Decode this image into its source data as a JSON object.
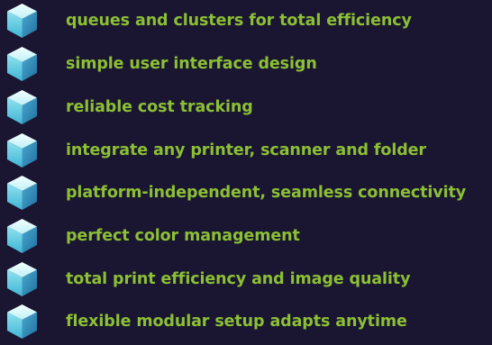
{
  "features": {
    "items": [
      {
        "label": "queues and clusters for total efficiency",
        "icon": "cube-icon"
      },
      {
        "label": "simple user interface design",
        "icon": "cube-icon"
      },
      {
        "label": "reliable cost tracking",
        "icon": "cube-icon"
      },
      {
        "label": "integrate any printer, scanner and folder",
        "icon": "cube-icon"
      },
      {
        "label": "platform-independent, seamless connectivity",
        "icon": "cube-icon"
      },
      {
        "label": "perfect color management",
        "icon": "cube-icon"
      },
      {
        "label": "total print efficiency and image quality",
        "icon": "cube-icon"
      },
      {
        "label": "flexible modular setup adapts anytime",
        "icon": "cube-icon"
      }
    ]
  },
  "colors": {
    "background": "#1a1530",
    "text": "#8bbf35",
    "cube_top": "#e8ffff",
    "cube_left": "#5cc9df",
    "cube_right": "#2e86b5"
  }
}
